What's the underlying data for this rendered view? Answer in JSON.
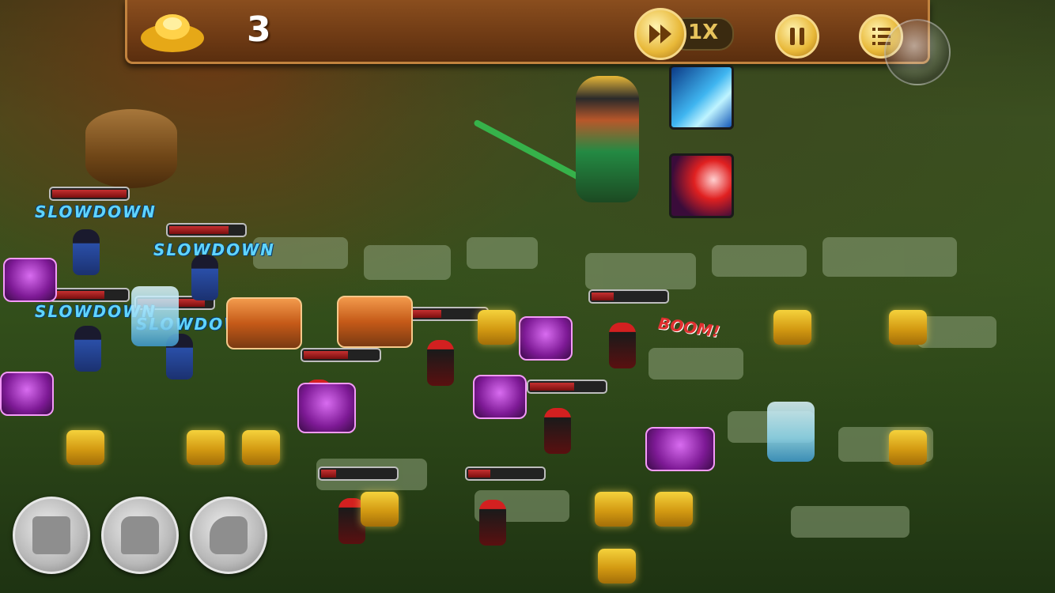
{
  "hud": {
    "gold_icon": "gold-ingot-icon",
    "gold_count": "3",
    "fast_forward_icon": "fast-forward-icon",
    "speed_label": "1X",
    "pause_icon": "pause-icon",
    "menu_icon": "list-menu-icon",
    "colors": {
      "bar": "#7a4216",
      "button_gold": "#e8b838"
    }
  },
  "skills": [
    {
      "icon": "ice-crystal-skill-icon"
    },
    {
      "icon": "slash-skill-icon"
    }
  ],
  "effects": {
    "slowdown_text": "SLOWDOWN",
    "boom_text": "BOOM!"
  },
  "health": [
    {
      "label": "enemy-1",
      "fill": 1.0
    },
    {
      "label": "enemy-2",
      "fill": 0.8
    },
    {
      "label": "enemy-3",
      "fill": 0.7
    },
    {
      "label": "enemy-4",
      "fill": 0.9
    },
    {
      "label": "enemy-5",
      "fill": 0.6
    },
    {
      "label": "enemy-6",
      "fill": 0.4
    },
    {
      "label": "enemy-7",
      "fill": 0.3
    },
    {
      "label": "enemy-8",
      "fill": 0.6
    },
    {
      "label": "enemy-9",
      "fill": 0.2
    },
    {
      "label": "enemy-10",
      "fill": 0.3
    }
  ],
  "build_menu": [
    {
      "icon": "cannon-cart-tower-icon"
    },
    {
      "icon": "idol-tower-icon"
    },
    {
      "icon": "catapult-tower-icon"
    }
  ]
}
